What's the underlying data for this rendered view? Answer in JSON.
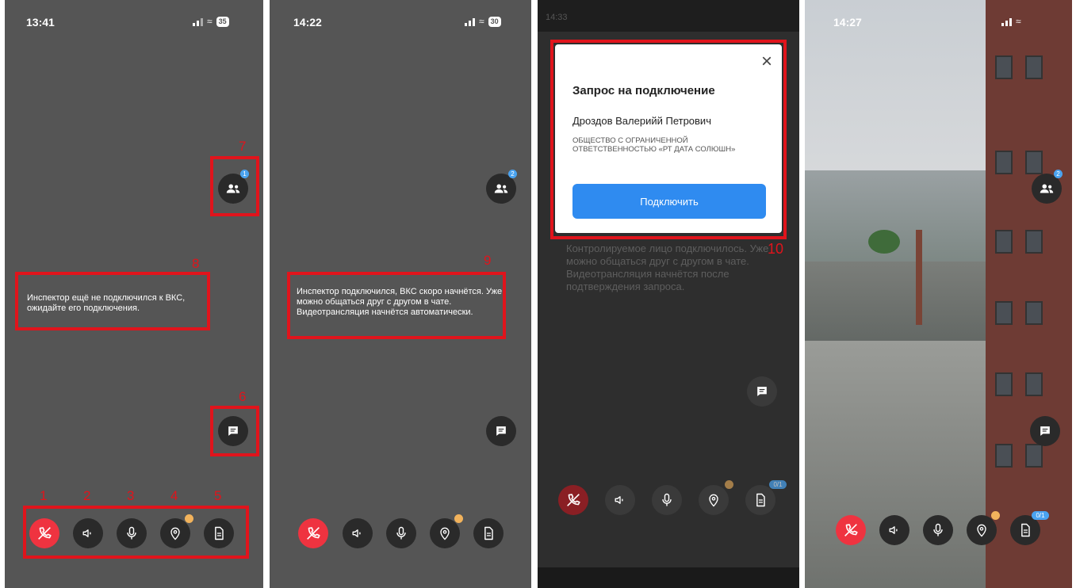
{
  "panels": [
    {
      "time": "13:41",
      "battery": "35",
      "participants_badge": "1",
      "message": "Инспектор ещё не подключился к ВКС, ожидайте его подключения."
    },
    {
      "time": "14:22",
      "battery": "30",
      "participants_badge": "2",
      "message": "Инспектор подключился, ВКС скоро начнётся. Уже можно общаться друг с другом в чате. Видеотрансляция начнётся автоматически."
    },
    {
      "time": "14:33",
      "message": "Контролируемое лицо подключилось. Уже можно общаться друг с другом в чате. Видеотрансляция начнётся после подтверждения запроса.",
      "doc_badge": "0/1",
      "dialog": {
        "title": "Запрос на подключение",
        "name": "Дроздов Валерийй Петрович",
        "organization": "ОБЩЕСТВО С ОГРАНИЧЕННОЙ ОТВЕТСТВЕННОСТЬЮ «РТ ДАТА СОЛЮШН»",
        "connect_label": "Подключить",
        "close_icon": "×"
      }
    },
    {
      "time": "14:27",
      "participants_badge": "2",
      "doc_badge": "0/1"
    }
  ],
  "annotations": {
    "n1": "1",
    "n2": "2",
    "n3": "3",
    "n4": "4",
    "n5": "5",
    "n6": "6",
    "n7": "7",
    "n8": "8",
    "n9": "9",
    "n10": "10"
  },
  "icons": {
    "end_call": "end-call-icon",
    "speaker": "speaker-icon",
    "microphone": "microphone-icon",
    "location": "location-icon",
    "document": "document-icon",
    "participants": "participants-icon",
    "chat": "chat-icon"
  },
  "colors": {
    "end_call": "#ef3340",
    "connect_button": "#2f8bf0",
    "highlight": "#e0141c",
    "badge_blue": "#4aa3f0",
    "badge_orange": "#f2b35c"
  }
}
